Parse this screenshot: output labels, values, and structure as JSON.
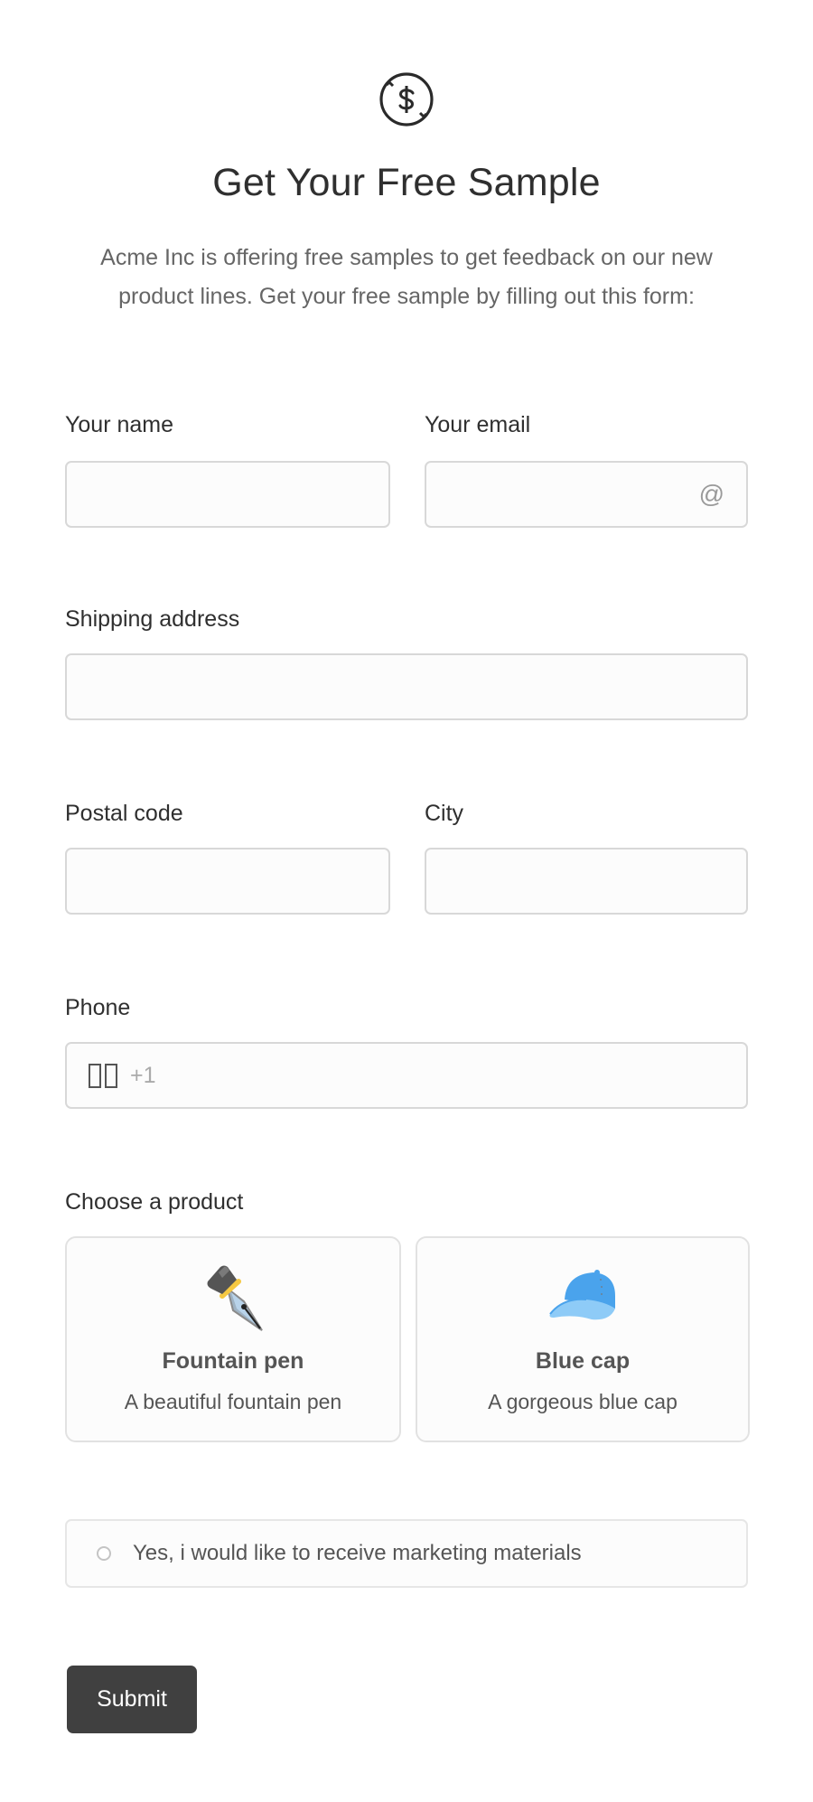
{
  "header": {
    "logo_icon": "dollar-crossed-circle-icon",
    "title": "Get Your Free Sample",
    "description": "Acme Inc is offering free samples to get feedback on our new product lines. Get your free sample by filling out this form:"
  },
  "form": {
    "name": {
      "label": "Your name",
      "value": "",
      "placeholder": ""
    },
    "email": {
      "label": "Your email",
      "value": "",
      "placeholder": "",
      "icon": "at-icon",
      "icon_glyph": "@"
    },
    "address": {
      "label": "Shipping address",
      "value": "",
      "placeholder": ""
    },
    "postal_code": {
      "label": "Postal code",
      "value": "",
      "placeholder": ""
    },
    "city": {
      "label": "City",
      "value": "",
      "placeholder": ""
    },
    "phone": {
      "label": "Phone",
      "flag_icon": "flag-icon",
      "dial_code": "+1",
      "value": "",
      "placeholder": ""
    },
    "product": {
      "label": "Choose a product",
      "options": [
        {
          "name": "Fountain pen",
          "description": "A beautiful fountain pen",
          "icon": "fountain-pen-icon",
          "selected": false
        },
        {
          "name": "Blue cap",
          "description": "A gorgeous blue cap",
          "icon": "blue-cap-icon",
          "selected": false
        }
      ]
    },
    "marketing_consent": {
      "label": "Yes, i would like to receive marketing materials",
      "checked": false
    },
    "submit_label": "Submit"
  },
  "colors": {
    "button_bg": "#404040",
    "input_border": "#d8d8d8",
    "cap_blue": "#4aa3ec",
    "cap_brim": "#8ecbf7"
  }
}
